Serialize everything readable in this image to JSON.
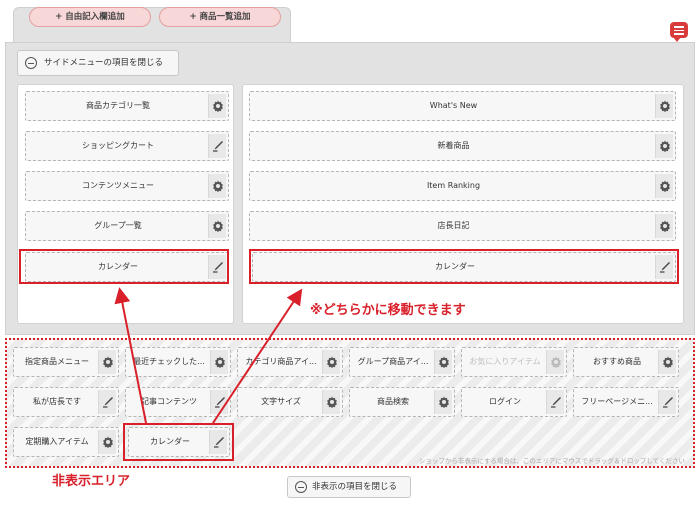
{
  "tabs": {
    "add_free_text": "+ 自由記入欄追加",
    "add_product_list": "+ 商品一覧追加"
  },
  "side_menu": {
    "close_label": "サイドメニューの項目を閉じる"
  },
  "left_column": {
    "items": [
      {
        "label": "商品カテゴリ一覧",
        "icon": "gear-icon"
      },
      {
        "label": "ショッピングカート",
        "icon": "pencil-icon"
      },
      {
        "label": "コンテンツメニュー",
        "icon": "gear-icon"
      },
      {
        "label": "グループ一覧",
        "icon": "gear-icon"
      },
      {
        "label": "カレンダー",
        "icon": "pencil-icon"
      }
    ]
  },
  "right_column": {
    "items": [
      {
        "label": "What's New",
        "icon": "gear-icon"
      },
      {
        "label": "新着商品",
        "icon": "gear-icon"
      },
      {
        "label": "Item Ranking",
        "icon": "gear-icon"
      },
      {
        "label": "店長日記",
        "icon": "gear-icon"
      },
      {
        "label": "カレンダー",
        "icon": "pencil-icon"
      }
    ]
  },
  "annotation_move": "※どちらかに移動できます",
  "hidden_area": {
    "label": "非表示エリア",
    "hint": "ショップから非表示にする場合は、このエリアにマウスでドラッグ＆ドロップしてください",
    "items": [
      {
        "label": "指定商品メニュー",
        "icon": "gear-icon"
      },
      {
        "label": "最近チェックした...",
        "icon": "gear-icon"
      },
      {
        "label": "カテゴリ商品アイ...",
        "icon": "gear-icon"
      },
      {
        "label": "グループ商品アイ...",
        "icon": "gear-icon"
      },
      {
        "label": "お気に入りアイテム",
        "icon": "gear-icon"
      },
      {
        "label": "おすすめ商品",
        "icon": "gear-icon"
      },
      {
        "label": "私が店長です",
        "icon": "pencil-icon"
      },
      {
        "label": "記事コンテンツ",
        "icon": "pencil-icon"
      },
      {
        "label": "文字サイズ",
        "icon": "gear-icon"
      },
      {
        "label": "商品検索",
        "icon": "gear-icon"
      },
      {
        "label": "ログイン",
        "icon": "pencil-icon"
      },
      {
        "label": "フリーページメニ...",
        "icon": "pencil-icon"
      },
      {
        "label": "定期購入アイテム",
        "icon": "gear-icon"
      },
      {
        "label": "カレンダー",
        "icon": "pencil-icon"
      }
    ],
    "close_label": "非表示の項目を閉じる"
  },
  "colors": {
    "accent": "#d9202a",
    "tab_pink": "#f7d7d7",
    "panel_gray": "#e2e2e2"
  }
}
